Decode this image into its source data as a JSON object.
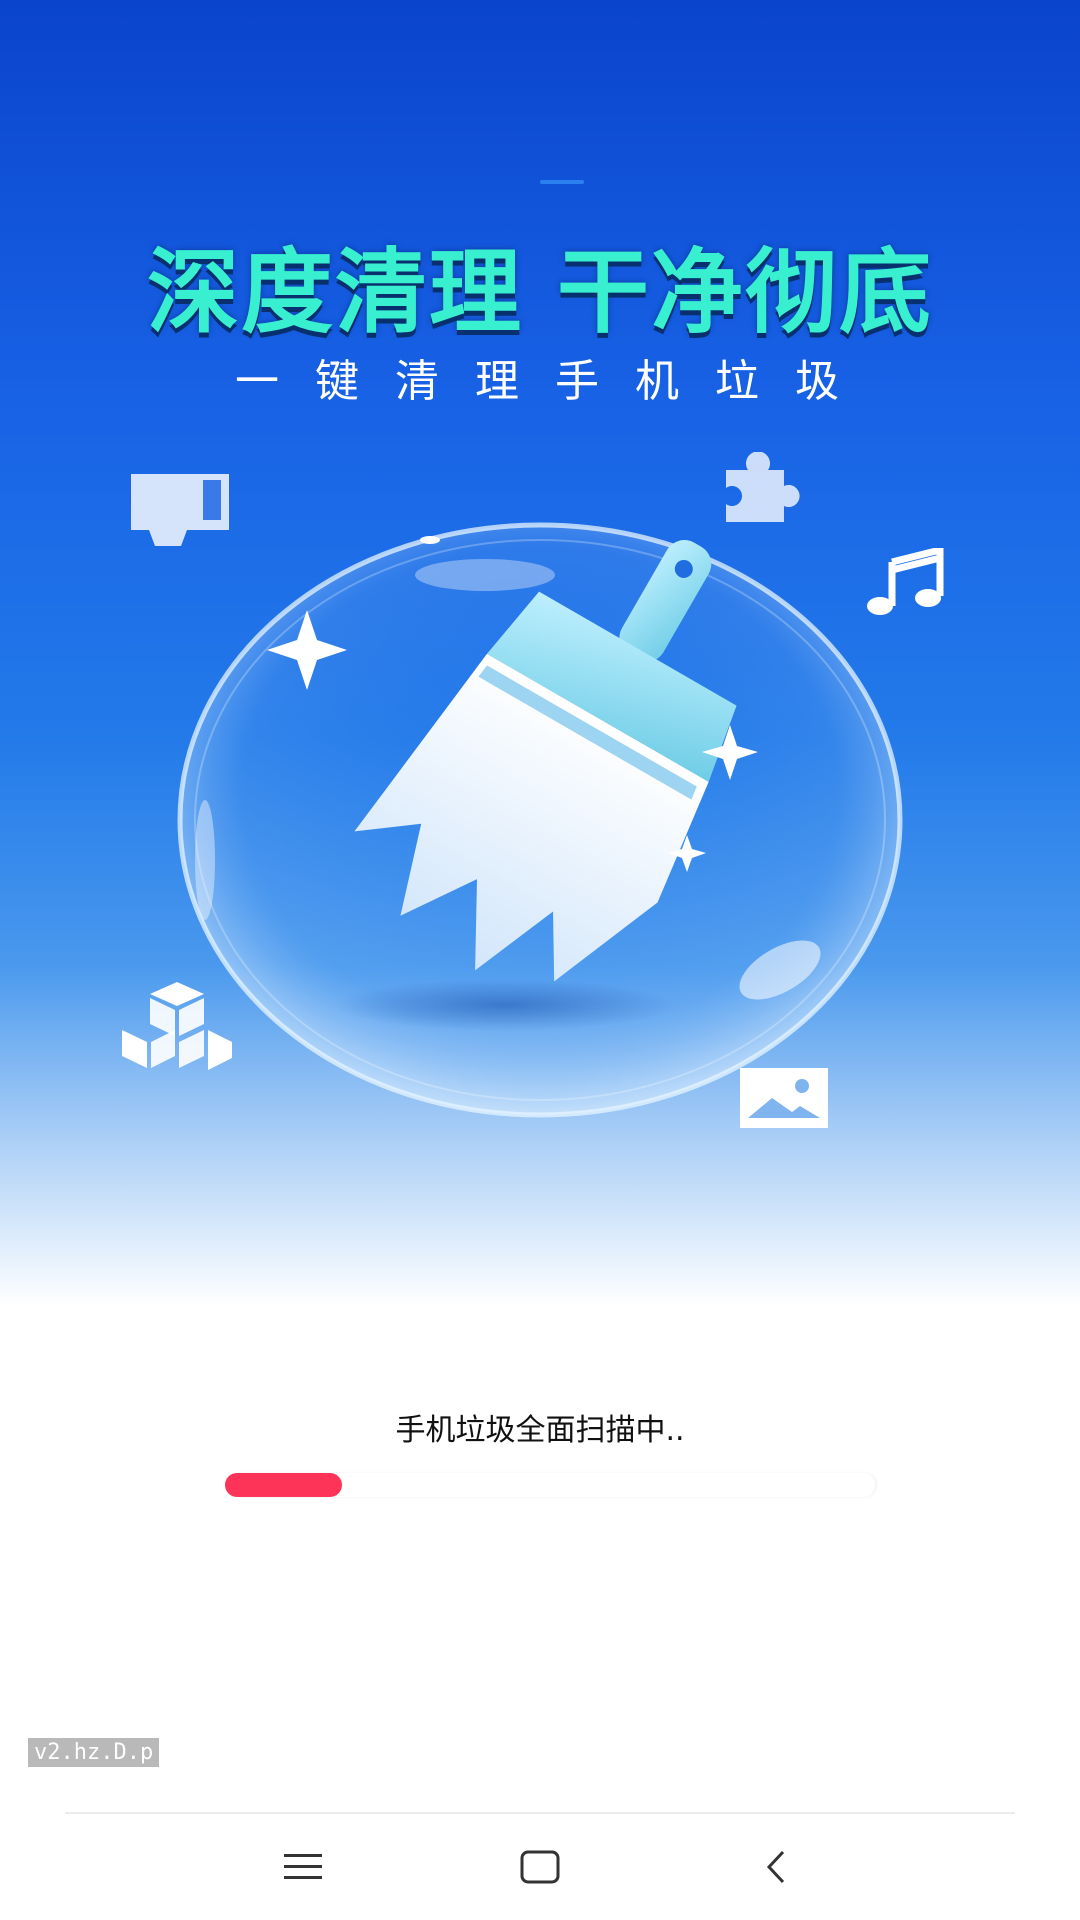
{
  "splash": {
    "headline": "深度清理 干净彻底",
    "subline": "一 键 清 理  手 机 垃 圾",
    "scan_status": "手机垃圾全面扫描中..",
    "progress_fraction": 0.18,
    "watermark": "v2.hz.D.p"
  },
  "icons": {
    "float_left_top": "sd-card-icon",
    "float_right_top": "puzzle-icon",
    "float_right_music": "music-note-icon",
    "float_left_bottom": "cubes-icon",
    "float_right_bottom": "image-icon",
    "center": "broom-bubble-icon"
  },
  "nav": {
    "menu": "menu-icon",
    "home": "home-icon",
    "back": "back-icon"
  },
  "colors": {
    "headline": "#38f0d0",
    "progress": "#fd3457",
    "hero_top": "#0a44cc"
  }
}
